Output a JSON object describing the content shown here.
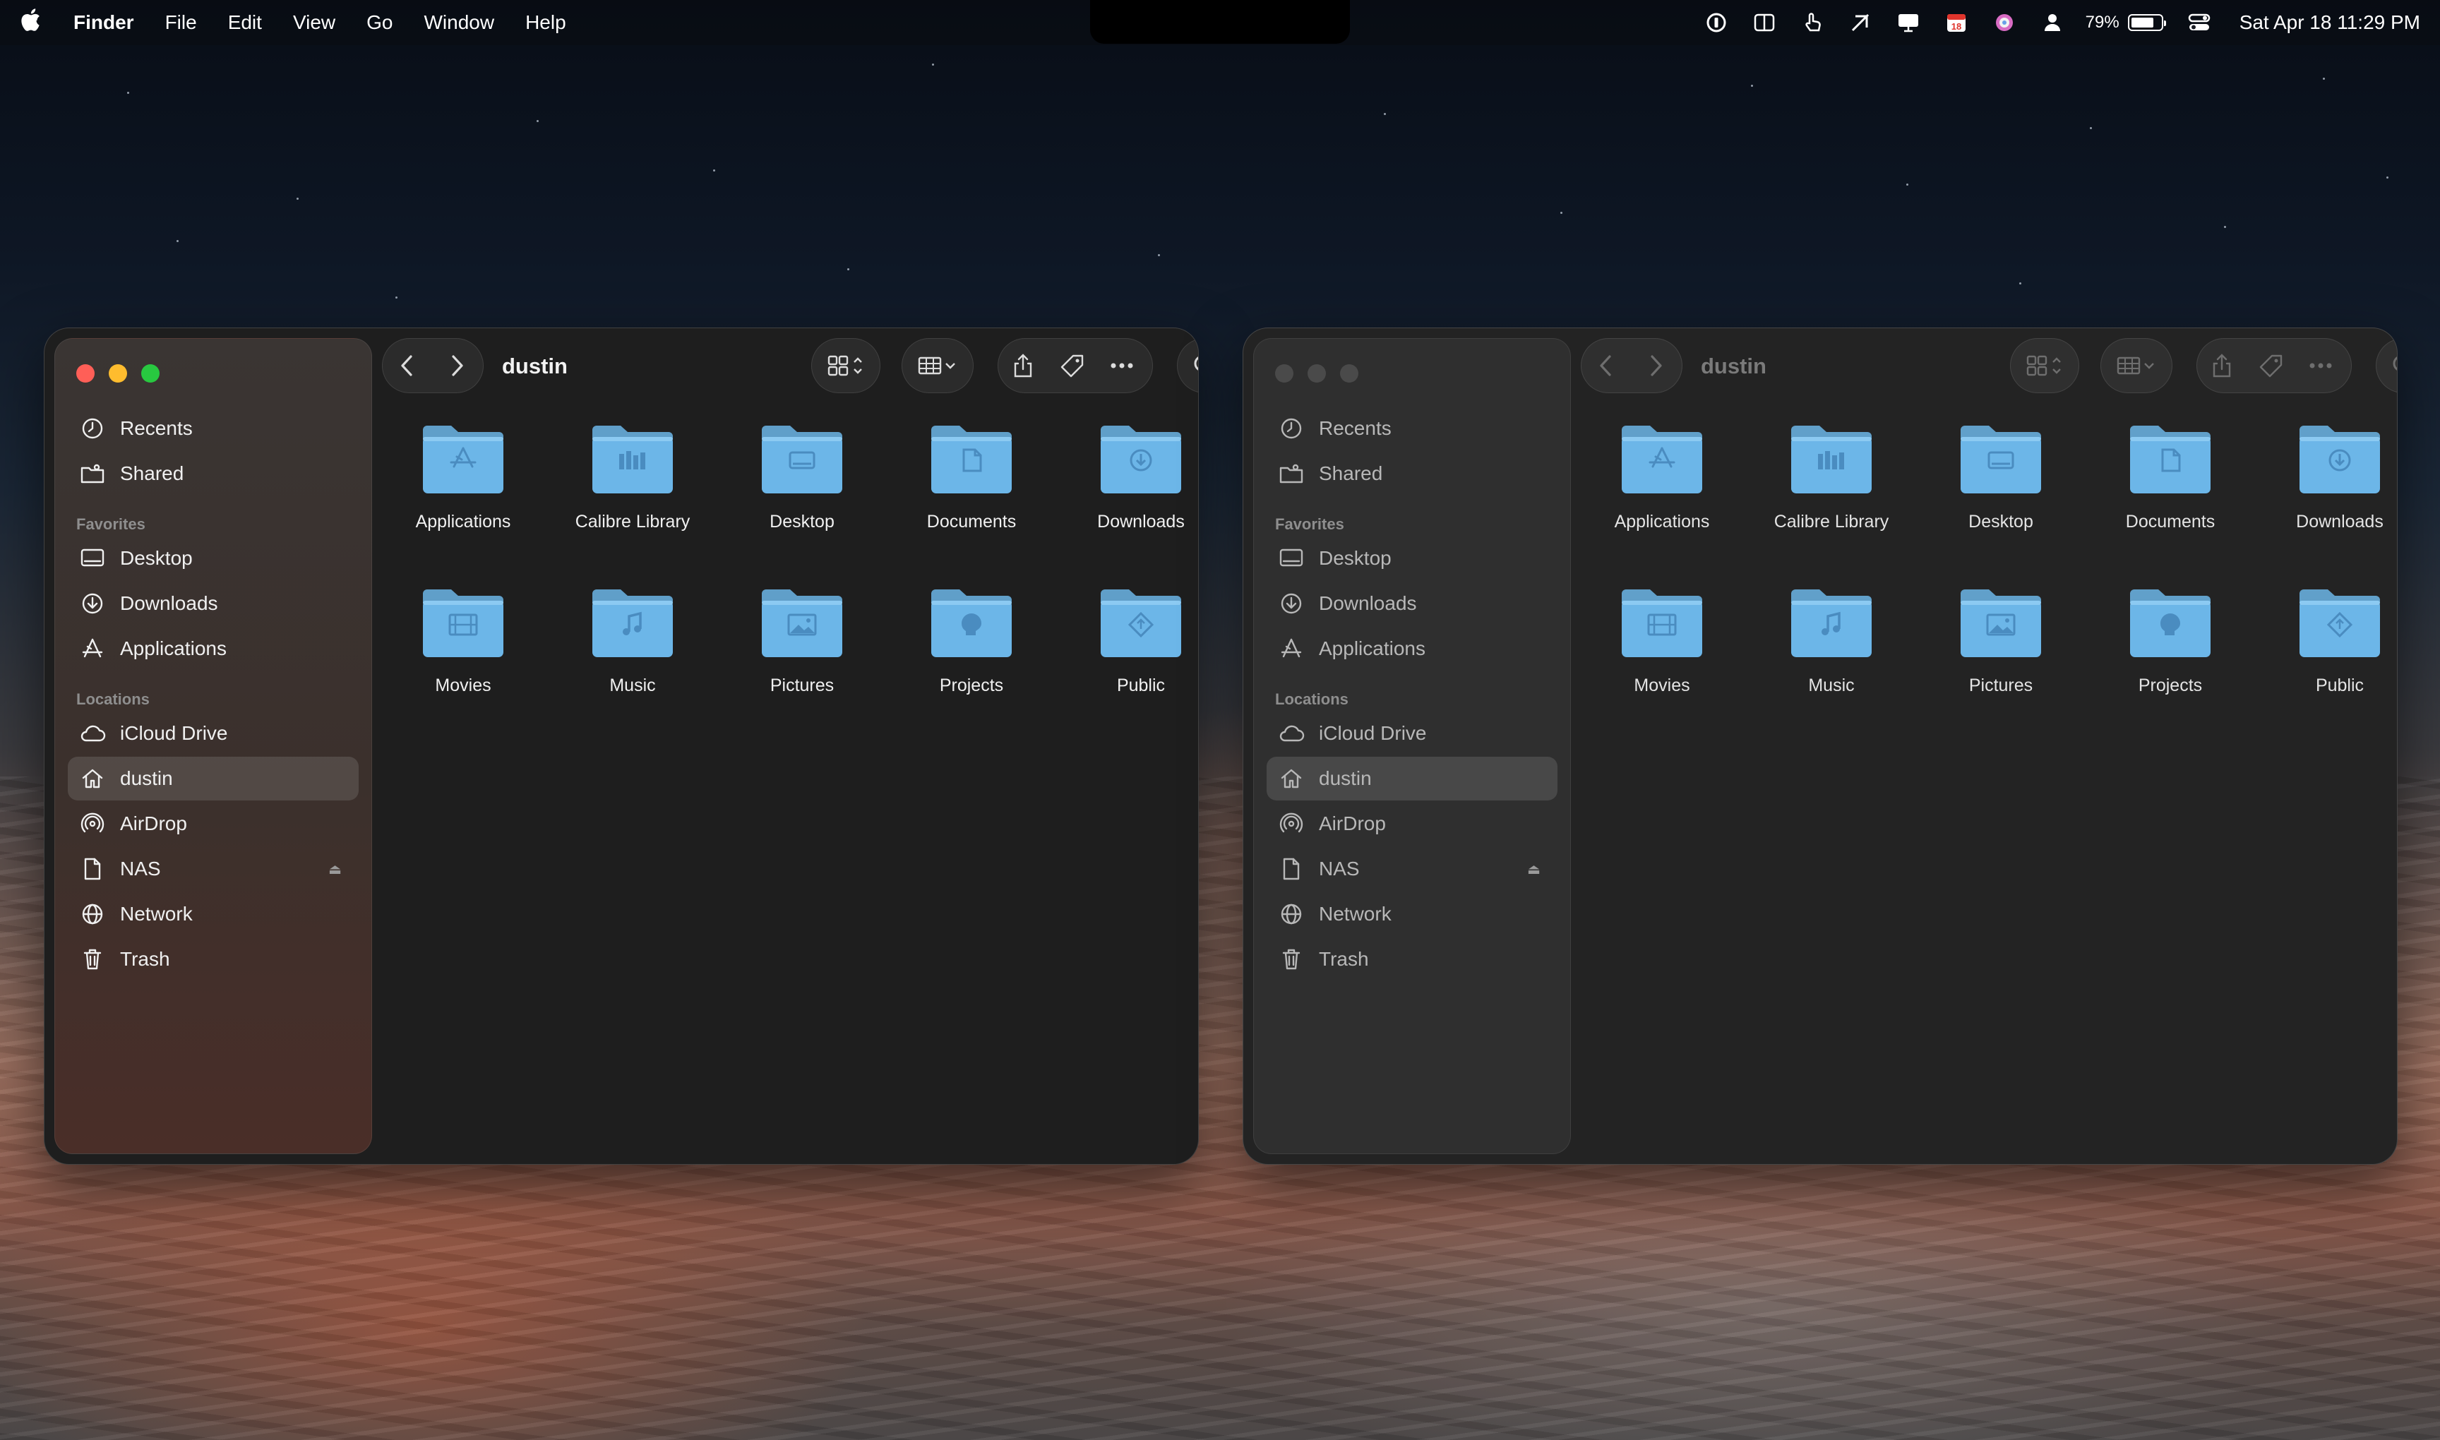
{
  "menubar": {
    "app_name": "Finder",
    "menus": [
      "File",
      "Edit",
      "View",
      "Go",
      "Window",
      "Help"
    ],
    "battery_percent": "79%",
    "battery_level": 0.79,
    "calendar_day": "18",
    "datetime": "Sat Apr 18  11:29 PM"
  },
  "traffic_colors": {
    "close": "#ff5f57",
    "minimize": "#febc2e",
    "zoom": "#28c840"
  },
  "folder_color": "#6cb6e8",
  "windows": [
    {
      "state": "active",
      "title": "dustin",
      "sidebar": {
        "top_items": [
          {
            "label": "Recents",
            "icon": "clock-icon"
          },
          {
            "label": "Shared",
            "icon": "shared-folder-icon"
          }
        ],
        "favorites_heading": "Favorites",
        "favorites": [
          {
            "label": "Desktop",
            "icon": "desktop-icon"
          },
          {
            "label": "Downloads",
            "icon": "download-icon"
          },
          {
            "label": "Applications",
            "icon": "applications-icon"
          }
        ],
        "locations_heading": "Locations",
        "locations": [
          {
            "label": "iCloud Drive",
            "icon": "cloud-icon"
          },
          {
            "label": "dustin",
            "icon": "home-icon",
            "selected": true
          },
          {
            "label": "AirDrop",
            "icon": "airdrop-icon"
          },
          {
            "label": "NAS",
            "icon": "document-icon",
            "eject": true
          },
          {
            "label": "Network",
            "icon": "globe-icon"
          },
          {
            "label": "Trash",
            "icon": "trash-icon"
          }
        ]
      },
      "items": [
        {
          "label": "Applications",
          "glyph": "applications"
        },
        {
          "label": "Calibre Library",
          "glyph": "library"
        },
        {
          "label": "Desktop",
          "glyph": "desktop"
        },
        {
          "label": "Documents",
          "glyph": "document"
        },
        {
          "label": "Downloads",
          "glyph": "download"
        },
        {
          "label": "Movies",
          "glyph": "film"
        },
        {
          "label": "Music",
          "glyph": "music"
        },
        {
          "label": "Pictures",
          "glyph": "picture"
        },
        {
          "label": "Projects",
          "glyph": "brain"
        },
        {
          "label": "Public",
          "glyph": "public"
        }
      ]
    },
    {
      "state": "inactive",
      "title": "dustin",
      "sidebar": {
        "top_items": [
          {
            "label": "Recents",
            "icon": "clock-icon"
          },
          {
            "label": "Shared",
            "icon": "shared-folder-icon"
          }
        ],
        "favorites_heading": "Favorites",
        "favorites": [
          {
            "label": "Desktop",
            "icon": "desktop-icon"
          },
          {
            "label": "Downloads",
            "icon": "download-icon"
          },
          {
            "label": "Applications",
            "icon": "applications-icon"
          }
        ],
        "locations_heading": "Locations",
        "locations": [
          {
            "label": "iCloud Drive",
            "icon": "cloud-icon"
          },
          {
            "label": "dustin",
            "icon": "home-icon",
            "selected": true
          },
          {
            "label": "AirDrop",
            "icon": "airdrop-icon"
          },
          {
            "label": "NAS",
            "icon": "document-icon",
            "eject": true
          },
          {
            "label": "Network",
            "icon": "globe-icon"
          },
          {
            "label": "Trash",
            "icon": "trash-icon"
          }
        ]
      },
      "items": [
        {
          "label": "Applications",
          "glyph": "applications"
        },
        {
          "label": "Calibre Library",
          "glyph": "library"
        },
        {
          "label": "Desktop",
          "glyph": "desktop"
        },
        {
          "label": "Documents",
          "glyph": "document"
        },
        {
          "label": "Downloads",
          "glyph": "download"
        },
        {
          "label": "Movies",
          "glyph": "film"
        },
        {
          "label": "Music",
          "glyph": "music"
        },
        {
          "label": "Pictures",
          "glyph": "picture"
        },
        {
          "label": "Projects",
          "glyph": "brain"
        },
        {
          "label": "Public",
          "glyph": "public"
        }
      ]
    }
  ]
}
